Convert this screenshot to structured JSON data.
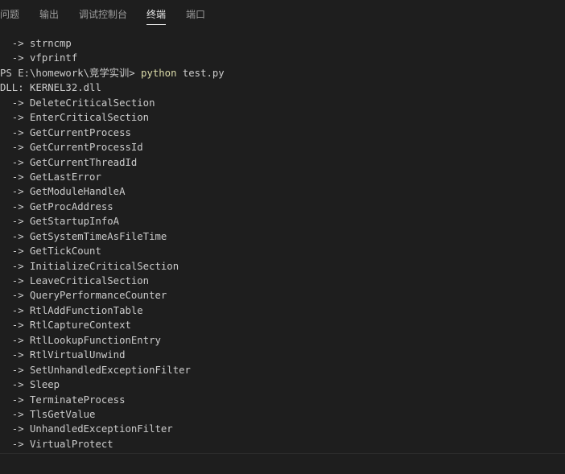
{
  "tabs": [
    {
      "label": "问题",
      "active": false
    },
    {
      "label": "输出",
      "active": false
    },
    {
      "label": "调试控制台",
      "active": false
    },
    {
      "label": "终端",
      "active": true
    },
    {
      "label": "端口",
      "active": false
    }
  ],
  "terminal": {
    "lines": [
      "  -> strncmp",
      "  -> vfprintf",
      "PS E:\\homework\\竞学实训> ",
      "DLL: KERNEL32.dll",
      "  -> DeleteCriticalSection",
      "  -> EnterCriticalSection",
      "  -> GetCurrentProcess",
      "  -> GetCurrentProcessId",
      "  -> GetCurrentThreadId",
      "  -> GetLastError",
      "  -> GetModuleHandleA",
      "  -> GetProcAddress",
      "  -> GetStartupInfoA",
      "  -> GetSystemTimeAsFileTime",
      "  -> GetTickCount",
      "  -> InitializeCriticalSection",
      "  -> LeaveCriticalSection",
      "  -> QueryPerformanceCounter",
      "  -> RtlAddFunctionTable",
      "  -> RtlCaptureContext",
      "  -> RtlLookupFunctionEntry",
      "  -> RtlVirtualUnwind",
      "  -> SetUnhandledExceptionFilter",
      "  -> Sleep",
      "  -> TerminateProcess",
      "  -> TlsGetValue",
      "  -> UnhandledExceptionFilter",
      "  -> VirtualProtect"
    ],
    "prompt_command": "python",
    "prompt_args": " test.py"
  },
  "colors": {
    "background": "#1e1e1e",
    "text": "#cccccc",
    "command": "#dcdcaa",
    "tab_inactive": "#9d9d9d",
    "tab_active": "#e7e7e7"
  }
}
